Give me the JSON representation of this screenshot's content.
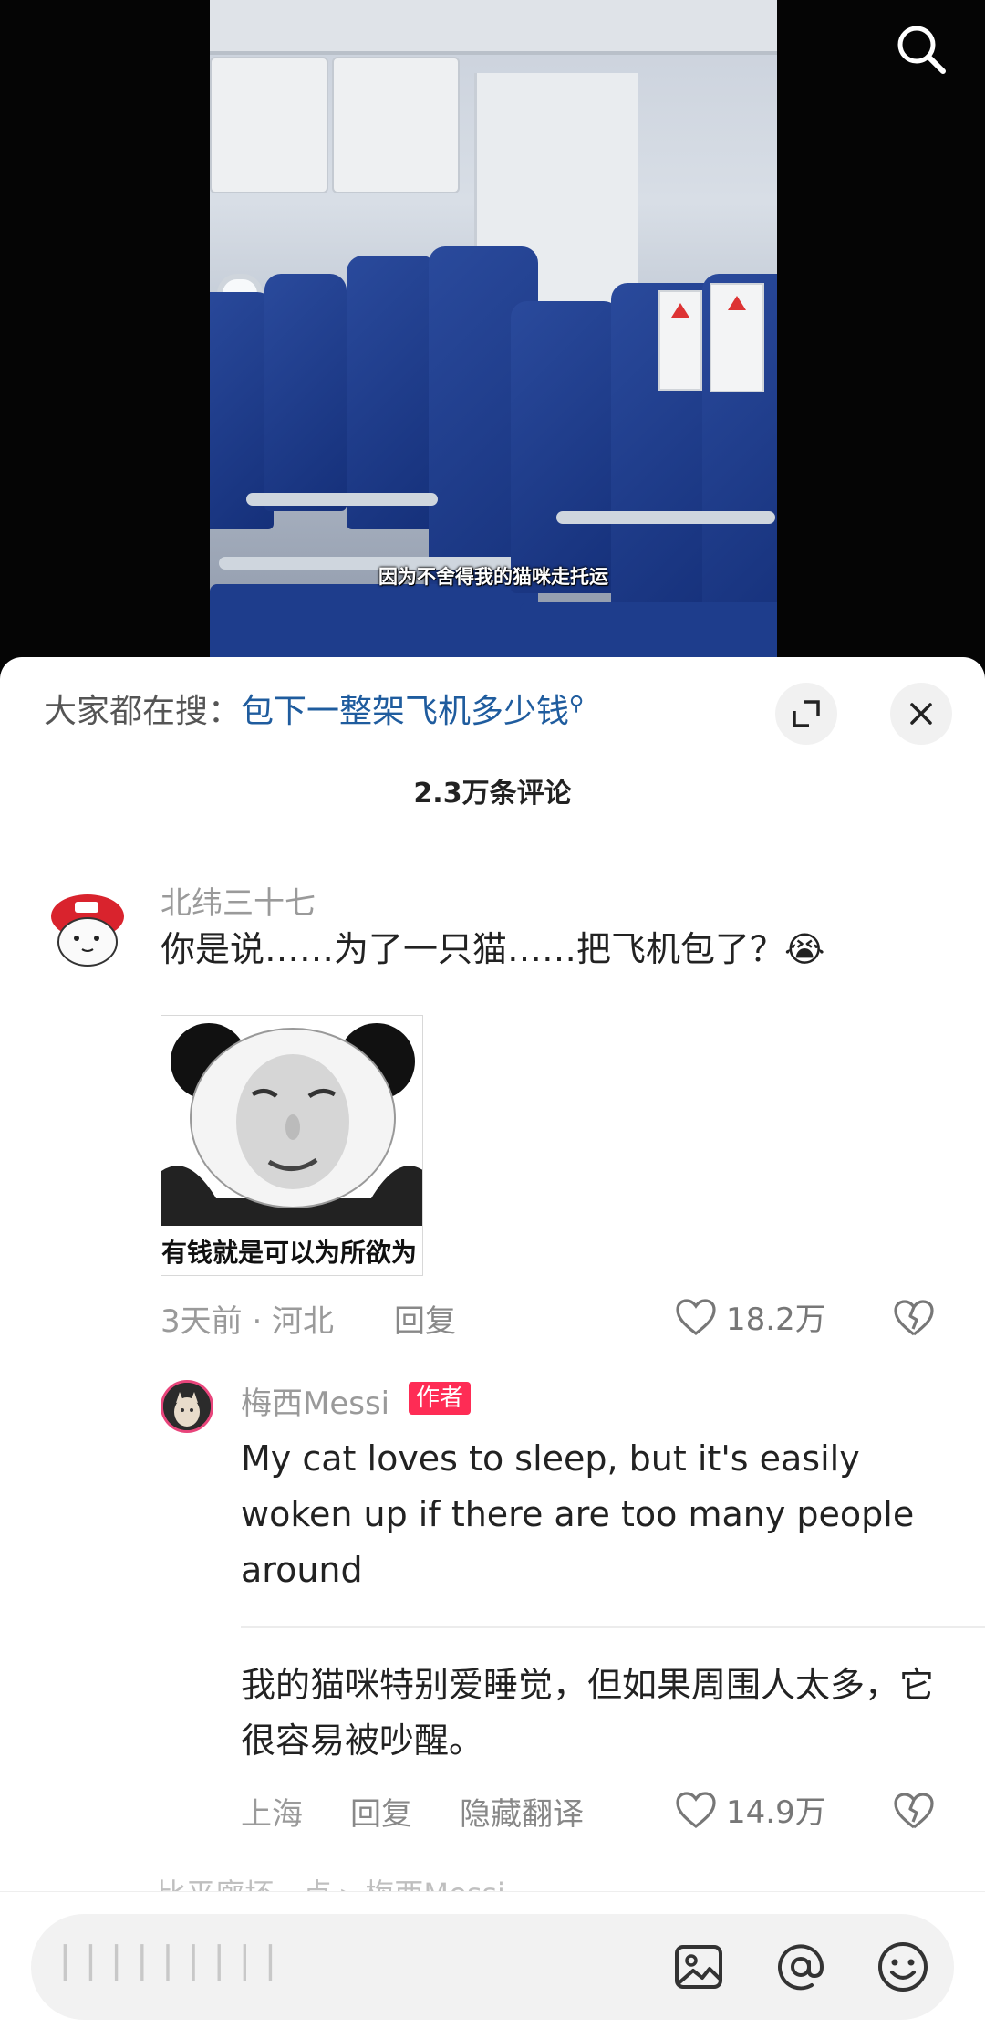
{
  "video": {
    "subtitle": "因为不舍得我的猫咪走托运"
  },
  "sheet": {
    "hot_search_prefix": "大家都在搜：",
    "hot_search_query": "包下一整架飞机多少钱",
    "comment_count": "2.3万条评论"
  },
  "comments": [
    {
      "username": "北纬三十七",
      "text": "你是说……为了一只猫……把飞机包了？😭",
      "meme_caption": "有钱就是可以为所欲为",
      "time_location": "3天前 · 河北",
      "reply_label": "回复",
      "likes": "18.2万",
      "replies": [
        {
          "username": "梅西Messi",
          "badge": "作者",
          "text_original": "My cat loves to sleep, but it's easily woken up if there are too many people around",
          "text_translated": "我的猫咪特别爱睡觉，但如果周围人太多，它很容易被吵醒。",
          "location": "上海",
          "reply_label": "回复",
          "hide_translation_label": "隐藏翻译",
          "likes": "14.9万"
        }
      ]
    }
  ],
  "next_reply_peek": "比平廊坏一点 ▸ 梅西Messi",
  "input": {
    "placeholder": "▏▏▏▏▏▏▏▏▏"
  },
  "icons": [
    "search-icon",
    "expand-icon",
    "close-icon",
    "heart-icon",
    "broken-heart-icon",
    "image-icon",
    "at-icon",
    "emoji-icon"
  ],
  "colors": {
    "link_blue": "#1f5c9e",
    "badge_red": "#fe2c55"
  }
}
